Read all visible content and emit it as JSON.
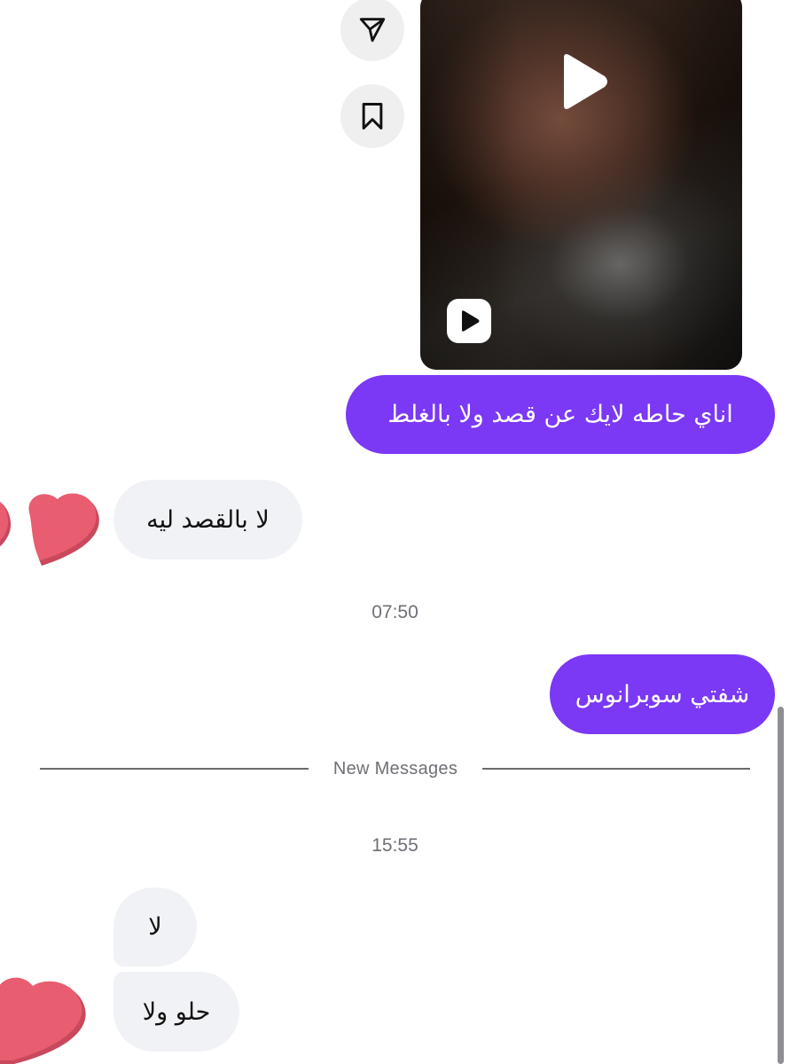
{
  "conversation": {
    "shared_video": {
      "share_icon": "paper-plane-icon",
      "save_icon": "bookmark-icon",
      "play_icon": "play-icon",
      "reel_icon": "reel-play-icon"
    },
    "messages": [
      {
        "direction": "outgoing",
        "text": "اناي حاطه لايك عن قصد ولا بالغلط"
      },
      {
        "direction": "incoming",
        "text": "لا بالقصد ليه"
      },
      {
        "direction": "outgoing",
        "text": "شفتي سوبرانوس"
      },
      {
        "direction": "incoming",
        "text": "لا"
      },
      {
        "direction": "incoming",
        "text": "حلو ولا"
      }
    ],
    "timestamps": [
      "07:50",
      "15:55"
    ],
    "new_messages_label": "New Messages",
    "reactions": {
      "heart_icon": "heart-icon",
      "heart_color": "#e85d70"
    }
  },
  "colors": {
    "outgoing_bubble": "#7b38f5",
    "incoming_bubble": "#f1f2f5",
    "timestamp_text": "#6f6f76"
  }
}
